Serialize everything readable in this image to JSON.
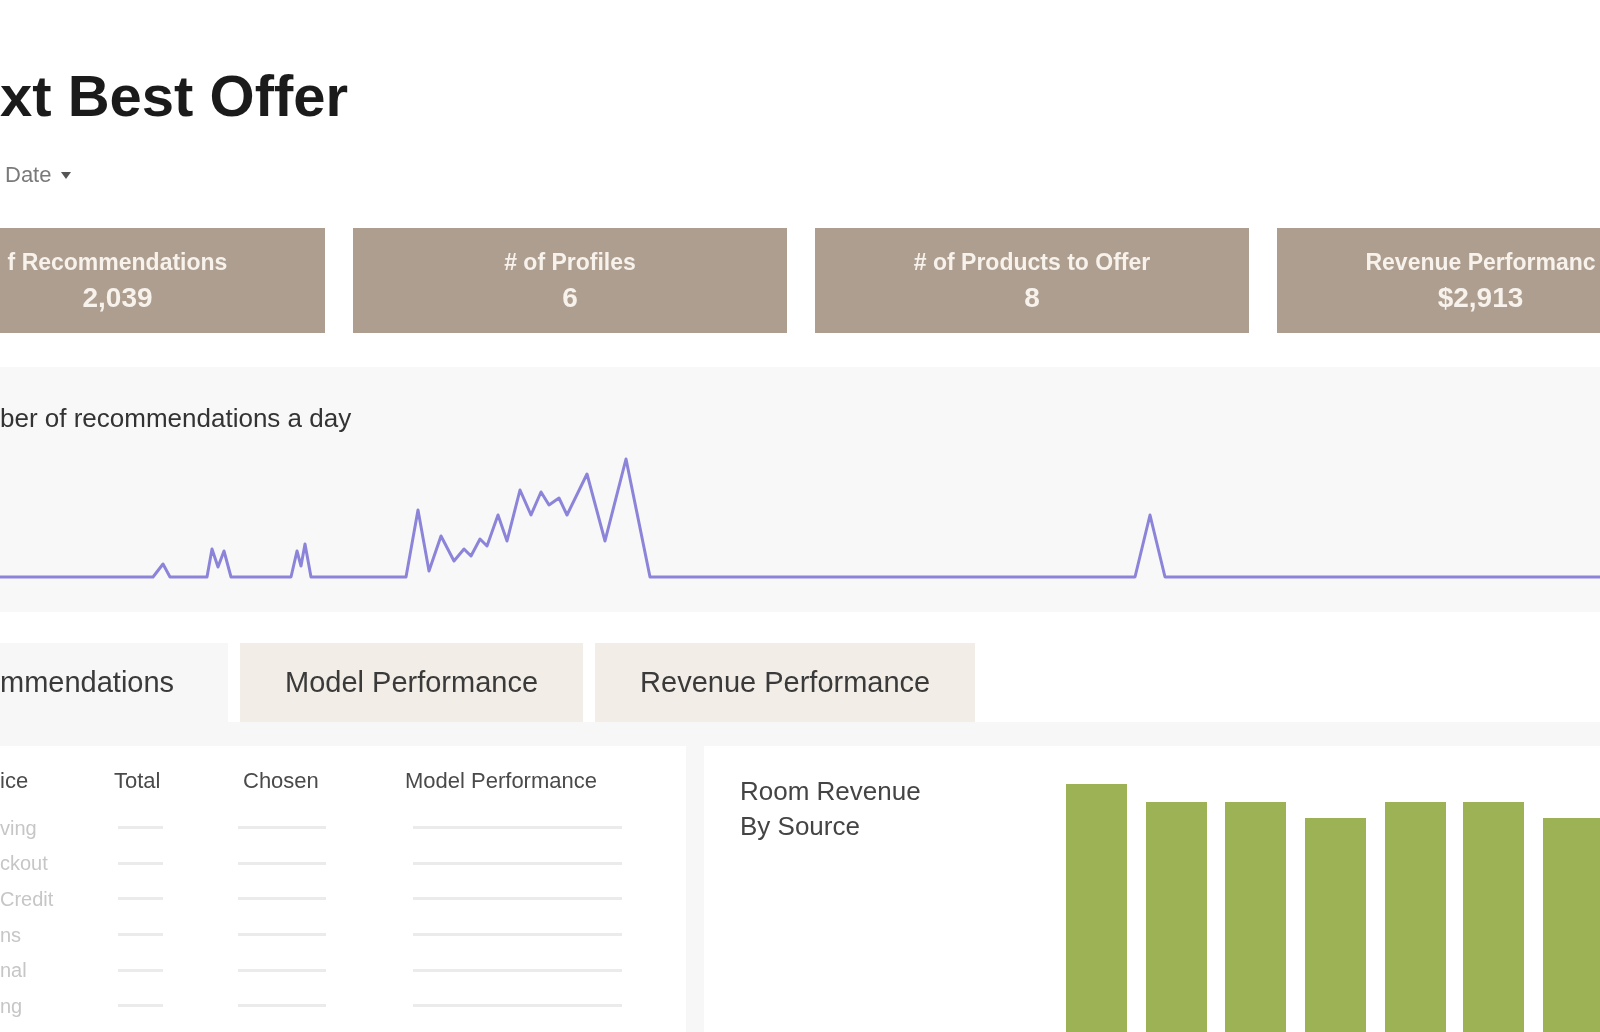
{
  "header": {
    "title": "xt Best Offer",
    "date_filter": "Date"
  },
  "kpi_cards": [
    {
      "label": "f Recommendations",
      "value": "2,039"
    },
    {
      "label": "# of Profiles",
      "value": "6"
    },
    {
      "label": "# of Products to Offer",
      "value": "8"
    },
    {
      "label": "Revenue Performanc",
      "value": "$2,913"
    }
  ],
  "daily_chart": {
    "title": "ber of recommendations a day"
  },
  "tabs": [
    {
      "label": "mmendations",
      "selected": true
    },
    {
      "label": "Model Performance",
      "selected": false
    },
    {
      "label": "Revenue Performance",
      "selected": false
    }
  ],
  "table": {
    "columns": [
      "ice",
      "Total",
      "Chosen",
      "Model Performance"
    ],
    "rows": [
      {
        "cells": [
          "ving"
        ]
      },
      {
        "cells": [
          "ckout"
        ]
      },
      {
        "cells": [
          "Credit"
        ]
      },
      {
        "cells": [
          "ns"
        ]
      },
      {
        "cells": [
          "nal"
        ]
      },
      {
        "cells": [
          "ng"
        ]
      }
    ]
  },
  "revenue_chart": {
    "title": "Room Revenue By Source"
  }
}
